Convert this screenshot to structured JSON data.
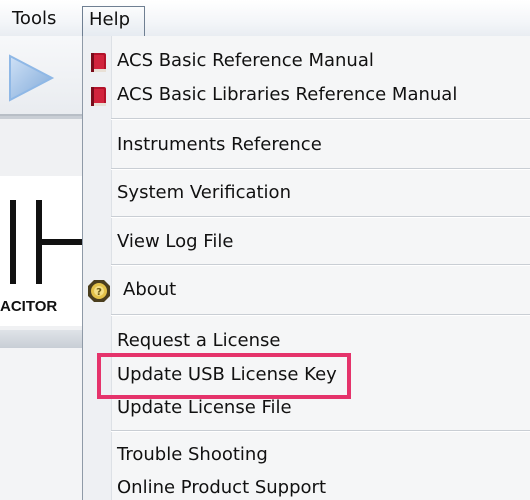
{
  "menubar": {
    "tools_label": "Tools",
    "help_label": "Help"
  },
  "background": {
    "component_label": "ACITOR"
  },
  "help_menu": {
    "items": [
      {
        "label": "ACS Basic Reference Manual",
        "icon": "book-icon"
      },
      {
        "label": "ACS Basic Libraries Reference Manual",
        "icon": "book-icon"
      },
      {
        "label": "Instruments Reference"
      },
      {
        "label": "System Verification"
      },
      {
        "label": "View Log File"
      },
      {
        "label": "About",
        "icon": "about-icon"
      },
      {
        "label": "Request a License"
      },
      {
        "label": "Update USB License Key",
        "highlighted": true
      },
      {
        "label": "Update License File"
      },
      {
        "label": "Trouble Shooting"
      },
      {
        "label": "Online Product Support"
      }
    ]
  },
  "colors": {
    "highlight_border": "#e5336b",
    "book_red": "#b3122a",
    "play_blue": "#8fb8e6"
  }
}
